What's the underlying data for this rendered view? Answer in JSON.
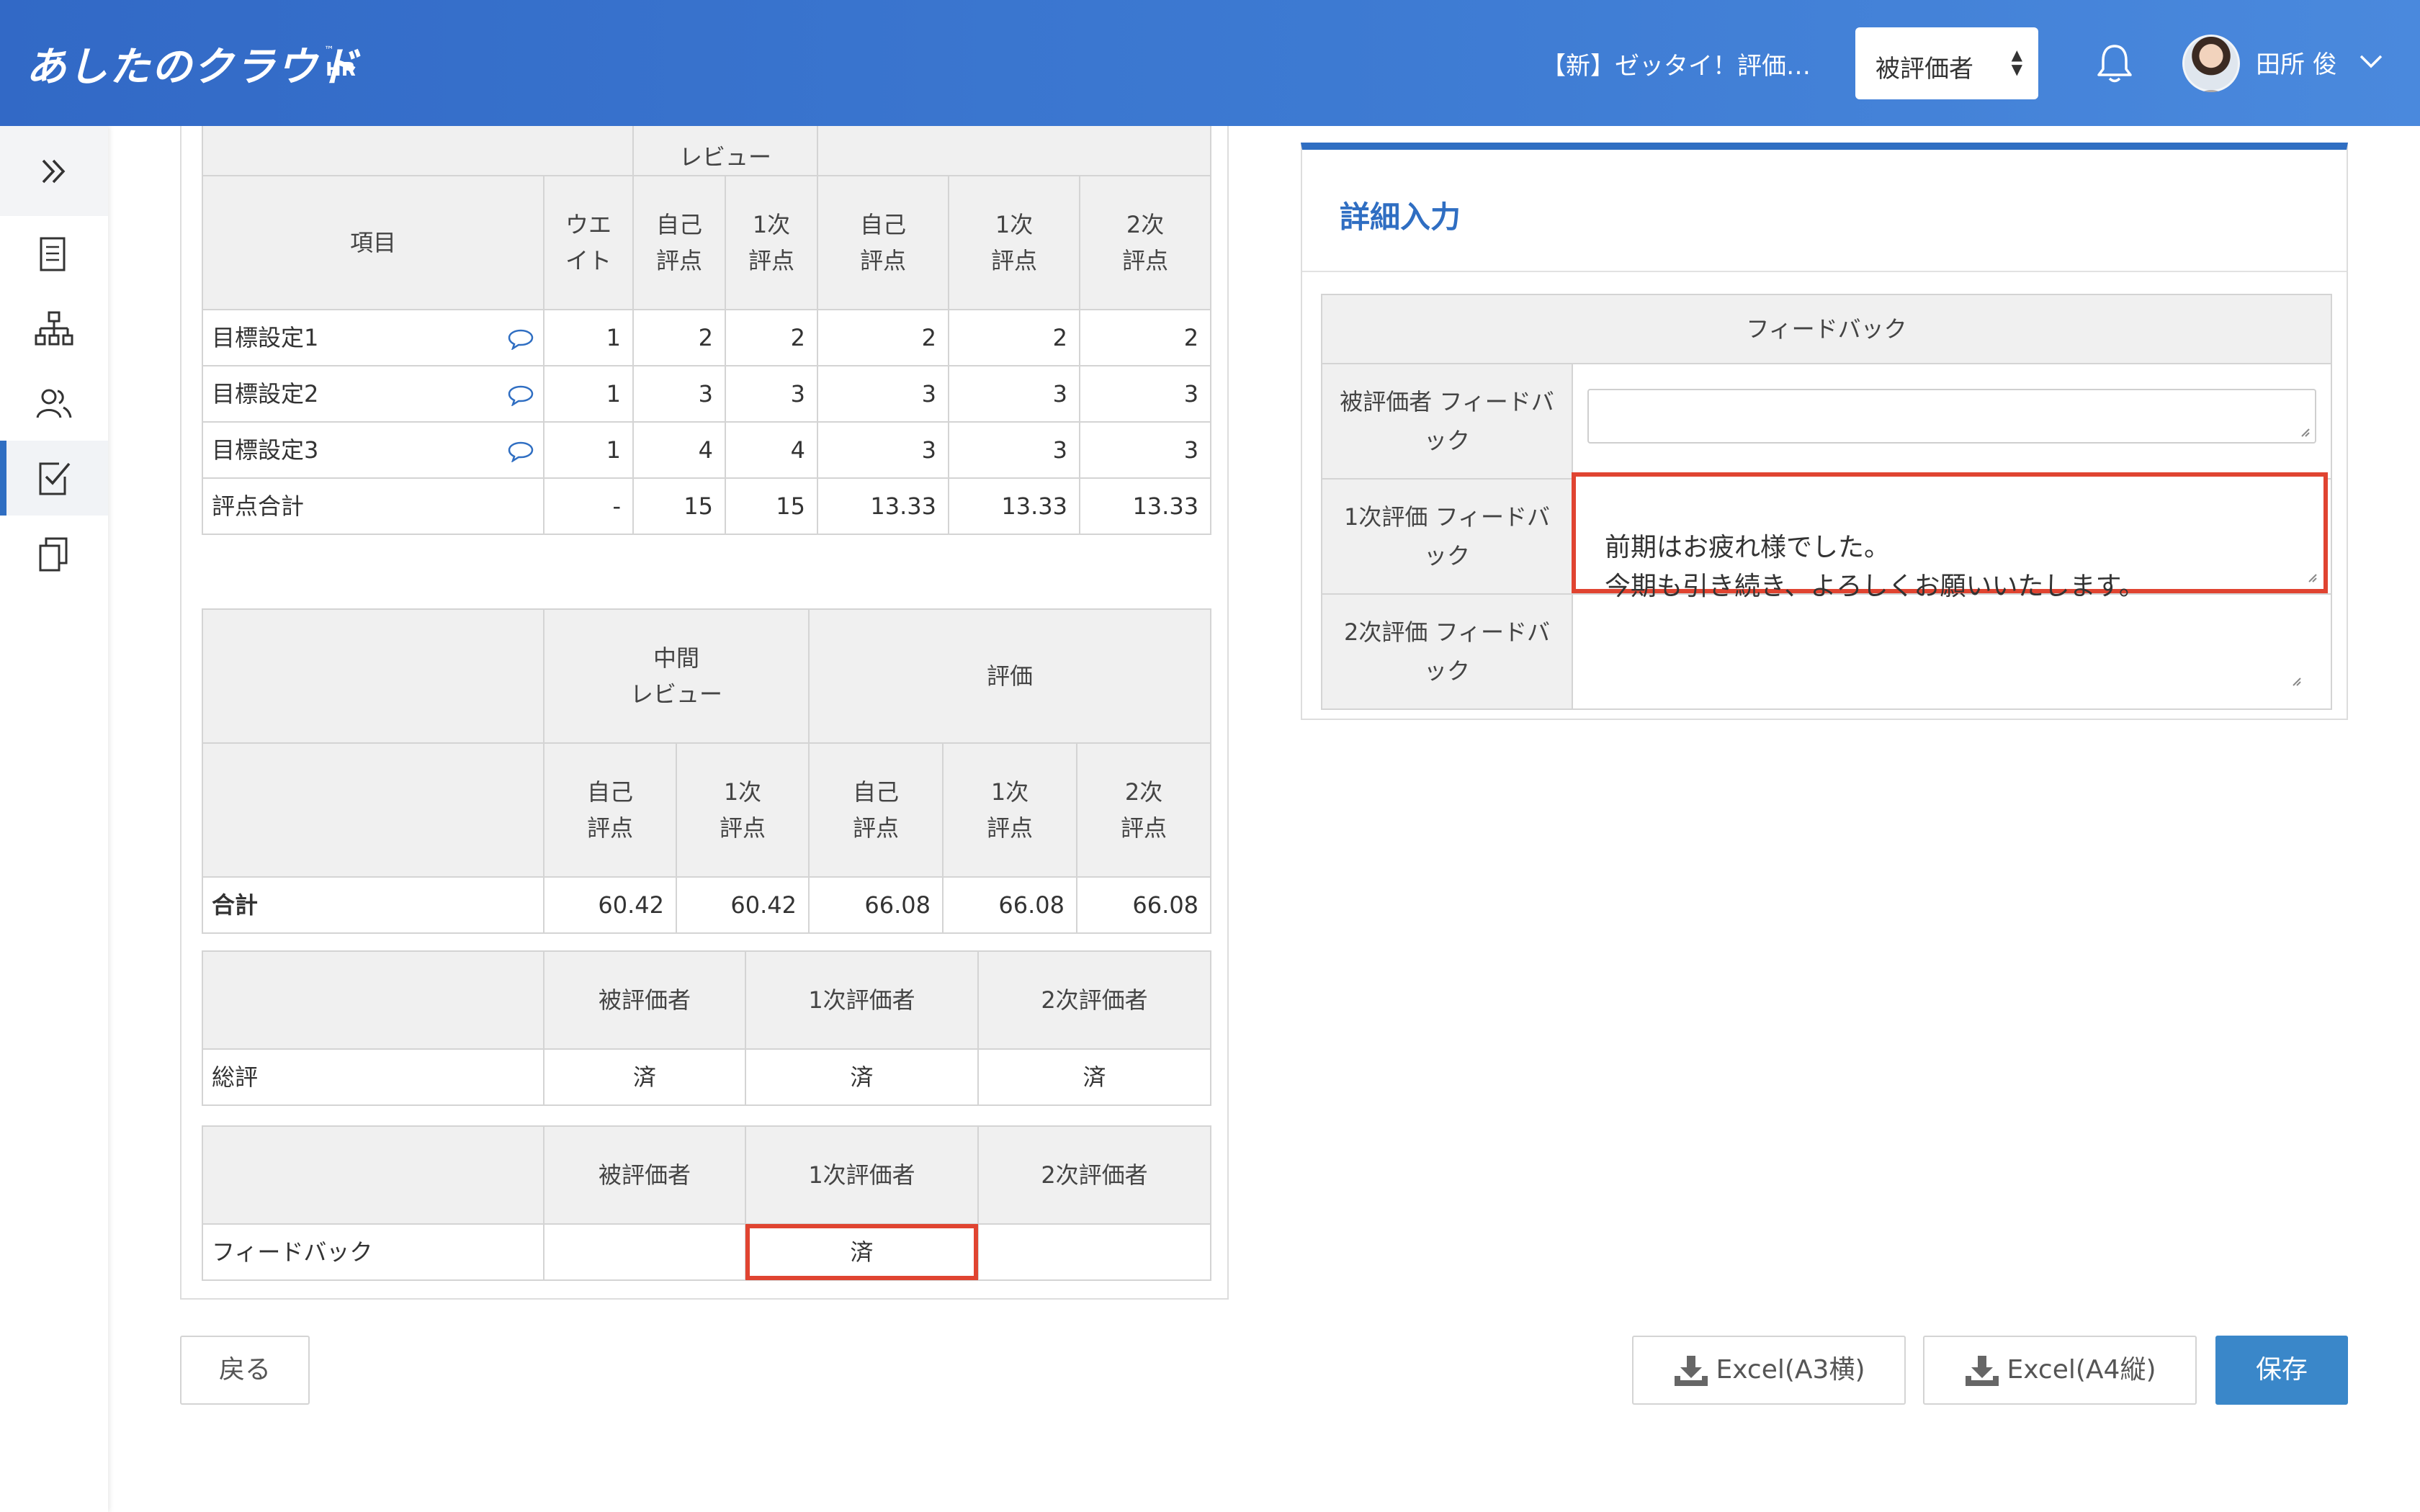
{
  "header": {
    "logo": "あしたのクラウド",
    "logo_sub": "HR",
    "logo_tm": "™",
    "sheet_title": "【新】ゼッタイ！評価…",
    "role_select": "被評価者",
    "user_name": "田所 俊",
    "icons": [
      "bell-icon",
      "avatar",
      "chevron-down-icon"
    ]
  },
  "sidebar": {
    "icons": [
      "double-chevron-right-icon",
      "document-icon",
      "org-chart-icon",
      "people-icon",
      "checklist-icon",
      "copy-icon"
    ],
    "active_index": 3
  },
  "goals_table": {
    "top_partial_label": "レビュー",
    "col_item": "項目",
    "col_weight": "ウエ\nイト",
    "col_mid_self": "自己\n評点",
    "col_mid_first": "1次\n評点",
    "col_eval_self": "自己\n評点",
    "col_eval_first": "1次\n評点",
    "col_eval_second": "2次\n評点",
    "rows": [
      {
        "item": "目標設定1",
        "weight": "1",
        "mid_self": "2",
        "mid_first": "2",
        "self": "2",
        "first": "2",
        "second": "2"
      },
      {
        "item": "目標設定2",
        "weight": "1",
        "mid_self": "3",
        "mid_first": "3",
        "self": "3",
        "first": "3",
        "second": "3"
      },
      {
        "item": "目標設定3",
        "weight": "1",
        "mid_self": "4",
        "mid_first": "4",
        "self": "3",
        "first": "3",
        "second": "3"
      }
    ],
    "total": {
      "item": "評点合計",
      "weight": "-",
      "mid_self": "15",
      "mid_first": "15",
      "self": "13.33",
      "first": "13.33",
      "second": "13.33"
    }
  },
  "summary_table": {
    "mid_review": "中間\nレビュー",
    "evaluation": "評価",
    "self_score": "自己\n評点",
    "first_score": "1次\n評点",
    "second_score": "2次\n評点",
    "total_label": "合計",
    "values": [
      "60.42",
      "60.42",
      "66.08",
      "66.08",
      "66.08"
    ]
  },
  "review_table": {
    "col_evaluatee": "被評価者",
    "col_first": "1次評価者",
    "col_second": "2次評価者",
    "row_label": "総評",
    "values": [
      "済",
      "済",
      "済"
    ]
  },
  "feedback_status_table": {
    "col_evaluatee": "被評価者",
    "col_first": "1次評価者",
    "col_second": "2次評価者",
    "row_label": "フィードバック",
    "values": [
      "",
      "済",
      ""
    ]
  },
  "detail_panel": {
    "title": "詳細入力",
    "feedback_header": "フィードバック",
    "rows": [
      {
        "label": "被評価者 フィードバ\nック",
        "value": ""
      },
      {
        "label": "1次評価 フィードバ\nック",
        "value": "前期はお疲れ様でした。\n今期も引き続き、よろしくお願いいたします。"
      },
      {
        "label": "2次評価 フィードバ\nック",
        "value": ""
      }
    ]
  },
  "buttons": {
    "back": "戻る",
    "excel_a3": "Excel(A3横)",
    "excel_a4": "Excel(A4縦)",
    "save": "保存"
  },
  "colors": {
    "header_blue": "#3d7ad2",
    "accent_blue": "#2f6ec2",
    "save_button": "#3a87c9",
    "highlight_red": "#e04431"
  }
}
